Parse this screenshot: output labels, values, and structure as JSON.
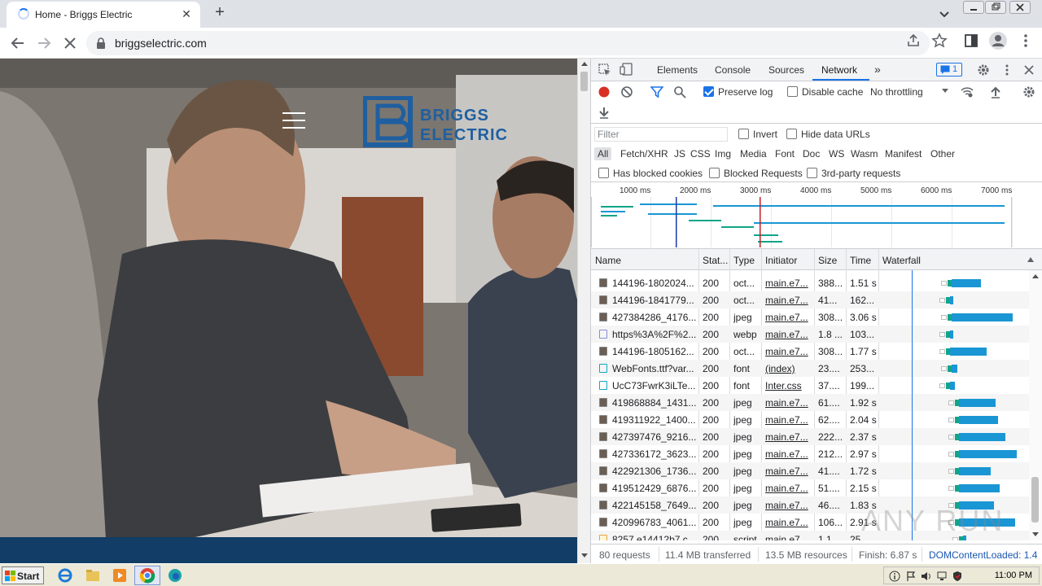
{
  "browser": {
    "tab_title": "Home - Briggs Electric",
    "url": "briggselectric.com"
  },
  "site": {
    "logo_line1": "BRIGGS",
    "logo_line2": "ELECTRIC"
  },
  "devtools": {
    "tabs": [
      "Elements",
      "Console",
      "Sources",
      "Network"
    ],
    "active_tab": "Network",
    "issues_count": "1",
    "toolbar": {
      "preserve_log": "Preserve log",
      "disable_cache": "Disable cache",
      "throttling": "No throttling"
    },
    "filter": {
      "placeholder": "Filter",
      "invert": "Invert",
      "hide_data_urls": "Hide data URLs",
      "types": [
        "All",
        "Fetch/XHR",
        "JS",
        "CSS",
        "Img",
        "Media",
        "Font",
        "Doc",
        "WS",
        "Wasm",
        "Manifest",
        "Other"
      ],
      "has_blocked_cookies": "Has blocked cookies",
      "blocked_requests": "Blocked Requests",
      "third_party": "3rd-party requests"
    },
    "overview_ticks": [
      "1000 ms",
      "2000 ms",
      "3000 ms",
      "4000 ms",
      "5000 ms",
      "6000 ms",
      "7000 ms"
    ],
    "columns": [
      "Name",
      "Stat...",
      "Type",
      "Initiator",
      "Size",
      "Time",
      "Waterfall"
    ],
    "rows": [
      {
        "name": "144196-1802024...",
        "status": "200",
        "type": "oct...",
        "initiator": "main.e7...",
        "size": "388...",
        "time": "1.51 s",
        "wf_start": 0.45,
        "wf_len": 0.2
      },
      {
        "name": "144196-1841779...",
        "status": "200",
        "type": "oct...",
        "initiator": "main.e7...",
        "size": "41...",
        "time": "162...",
        "wf_start": 0.44,
        "wf_len": 0.02
      },
      {
        "name": "427384286_4176...",
        "status": "200",
        "type": "jpeg",
        "initiator": "main.e7...",
        "size": "308...",
        "time": "3.06 s",
        "wf_start": 0.45,
        "wf_len": 0.42
      },
      {
        "name": "https%3A%2F%2...",
        "status": "200",
        "type": "webp",
        "initiator": "main.e7...",
        "size": "1.8 ...",
        "time": "103...",
        "wf_start": 0.44,
        "wf_len": 0.02
      },
      {
        "name": "144196-1805162...",
        "status": "200",
        "type": "oct...",
        "initiator": "main.e7...",
        "size": "308...",
        "time": "1.77 s",
        "wf_start": 0.44,
        "wf_len": 0.25
      },
      {
        "name": "WebFonts.ttf?var...",
        "status": "200",
        "type": "font",
        "initiator": "(index)",
        "size": "23....",
        "time": "253...",
        "wf_start": 0.45,
        "wf_len": 0.04
      },
      {
        "name": "UcC73FwrK3iLTe...",
        "status": "200",
        "type": "font",
        "initiator": "Inter.css",
        "size": "37....",
        "time": "199...",
        "wf_start": 0.44,
        "wf_len": 0.03
      },
      {
        "name": "419868884_1431...",
        "status": "200",
        "type": "jpeg",
        "initiator": "main.e7...",
        "size": "61....",
        "time": "1.92 s",
        "wf_start": 0.5,
        "wf_len": 0.25
      },
      {
        "name": "419311922_1400...",
        "status": "200",
        "type": "jpeg",
        "initiator": "main.e7...",
        "size": "62....",
        "time": "2.04 s",
        "wf_start": 0.5,
        "wf_len": 0.27
      },
      {
        "name": "427397476_9216...",
        "status": "200",
        "type": "jpeg",
        "initiator": "main.e7...",
        "size": "222...",
        "time": "2.37 s",
        "wf_start": 0.5,
        "wf_len": 0.32
      },
      {
        "name": "427336172_3623...",
        "status": "200",
        "type": "jpeg",
        "initiator": "main.e7...",
        "size": "212...",
        "time": "2.97 s",
        "wf_start": 0.5,
        "wf_len": 0.4
      },
      {
        "name": "422921306_1736...",
        "status": "200",
        "type": "jpeg",
        "initiator": "main.e7...",
        "size": "41....",
        "time": "1.72 s",
        "wf_start": 0.5,
        "wf_len": 0.22
      },
      {
        "name": "419512429_6876...",
        "status": "200",
        "type": "jpeg",
        "initiator": "main.e7...",
        "size": "51....",
        "time": "2.15 s",
        "wf_start": 0.5,
        "wf_len": 0.28
      },
      {
        "name": "422145158_7649...",
        "status": "200",
        "type": "jpeg",
        "initiator": "main.e7...",
        "size": "46....",
        "time": "1.83 s",
        "wf_start": 0.5,
        "wf_len": 0.24
      },
      {
        "name": "420996783_4061...",
        "status": "200",
        "type": "jpeg",
        "initiator": "main.e7...",
        "size": "106...",
        "time": "2.91 s",
        "wf_start": 0.5,
        "wf_len": 0.39
      },
      {
        "name": "8257.e14412b7.c...",
        "status": "200",
        "type": "script",
        "initiator": "main.e7...",
        "size": "1.1 ...",
        "time": "25 ...",
        "wf_start": 0.53,
        "wf_len": 0.02
      }
    ],
    "status": {
      "requests": "80 requests",
      "transferred": "11.4 MB transferred",
      "resources": "13.5 MB resources",
      "finish": "Finish: 6.87 s",
      "dom_loaded": "DOMContentLoaded: 1.4"
    }
  },
  "watermark": "ANY RUN",
  "taskbar": {
    "start_label": "Start",
    "clock": "11:00 PM"
  },
  "colors": {
    "waterfall_download": "#1a96d4",
    "waterfall_wait": "#10a58a",
    "accent": "#1a73e8",
    "site_footer": "#113d66",
    "logo": "#1f5fa0"
  }
}
